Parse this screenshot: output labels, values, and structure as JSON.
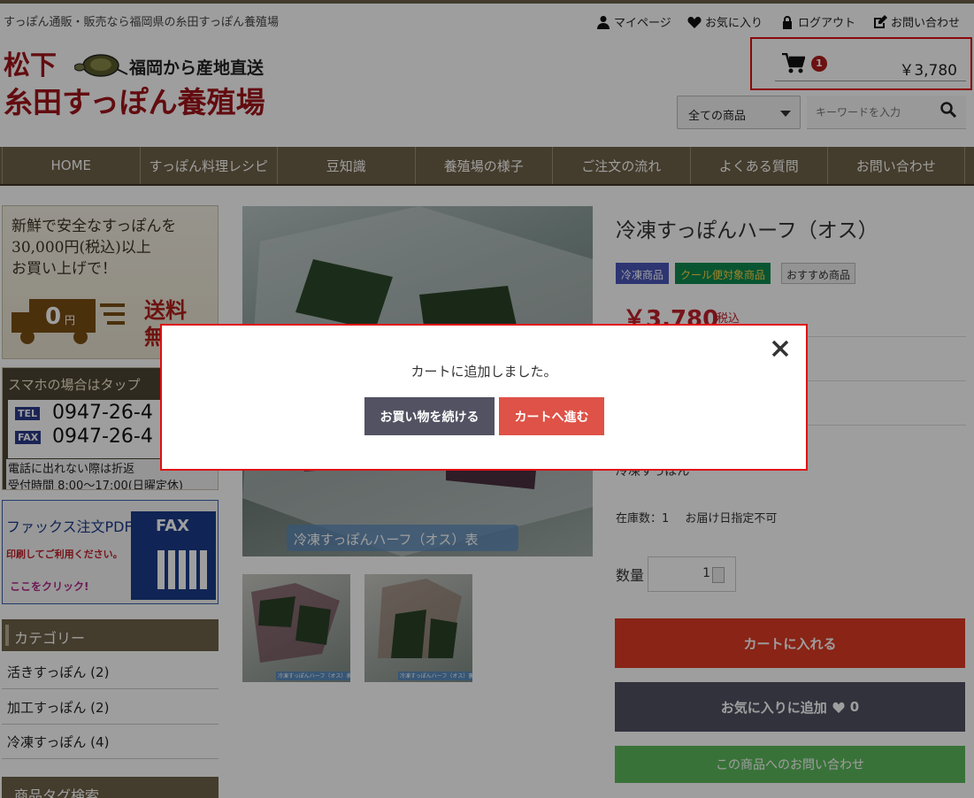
{
  "header": {
    "tagline": "すっぽん通販・販売なら福岡県の糸田すっぽん養殖場",
    "util_links": [
      {
        "label": "マイページ",
        "icon": "user-icon"
      },
      {
        "label": "お気に入り",
        "icon": "heart-icon"
      },
      {
        "label": "ログアウト",
        "icon": "lock-icon"
      },
      {
        "label": "お問い合わせ",
        "icon": "edit-icon"
      }
    ],
    "logo": {
      "name": "松下",
      "sub": "福岡から産地直送",
      "sub2": "糸田すっぽん養殖場"
    },
    "cart": {
      "count": "1",
      "amount": "￥3,780",
      "icon": "cart-icon"
    },
    "search": {
      "category": "全ての商品",
      "placeholder": "キーワードを入力",
      "icon": "search-icon"
    }
  },
  "nav": [
    "HOME",
    "すっぽん料理レシピ",
    "豆知識",
    "養殖場の様子",
    "ご注文の流れ",
    "よくある質問",
    "お問い合わせ"
  ],
  "sidebar": {
    "banner_free": {
      "line1": "新鮮で安全なすっぽんを",
      "line2": "30,000円(税込)以上",
      "line3": "お買い上げで！",
      "truck_price": "0",
      "truck_unit": "円",
      "free1": "送料",
      "free2": "無料"
    },
    "banner_phone": {
      "title": "スマホの場合はタップ",
      "tel_label": "TEL",
      "tel": "0947-26-4",
      "fax_label": "FAX",
      "fax": "0947-26-4",
      "note1": "電話に出れない際は折返",
      "note2": "受付時間 8:00〜17:00(日曜定休)"
    },
    "banner_fax": {
      "title": "ファックス注文PDF",
      "line1": "印刷してご利用ください。",
      "line2": "ここをクリック!",
      "fax_label": "FAX"
    },
    "category_heading": "カテゴリー",
    "categories": [
      {
        "label": "活きすっぽん (2)"
      },
      {
        "label": "加工すっぽん (2)"
      },
      {
        "label": "冷凍すっぽん (4)"
      }
    ],
    "tag_heading": "商品タグ検索"
  },
  "product": {
    "image_caption": "冷凍すっぽんハーフ（オス）表",
    "thumb1_caption": "冷凍すっぽんハーフ（オス）表",
    "thumb2_caption": "冷凍すっぽんハーフ（オス）裏",
    "title": "冷凍すっぽんハーフ（オス）",
    "tags": [
      "冷凍商品",
      "クール便対象商品",
      "おすすめ商品"
    ],
    "tag_colors": [
      "#4a56b8",
      "#0f8a4f",
      "#eeeeee"
    ],
    "price": "￥3,780",
    "tax": "税込",
    "partial_category": "冷凍すっぽん",
    "stock_label": "在庫数：1",
    "delivery_note": "お届け日指定不可",
    "qty_label": "数量",
    "qty_value": "1",
    "add_to_cart": "カートに入れる",
    "add_fav": "お気に入りに追加",
    "fav_count": "0",
    "inquiry": "この商品へのお問い合わせ"
  },
  "modal": {
    "message": "カートに追加しました。",
    "continue_label": "お買い物を続ける",
    "to_cart_label": "カートへ進む",
    "close_icon": "close-icon"
  },
  "colors": {
    "brand": "#6e6148",
    "cart_btn": "#de3a25",
    "fav_btn": "#525263",
    "inq_btn": "#5cb85c",
    "price": "#c0202a"
  }
}
